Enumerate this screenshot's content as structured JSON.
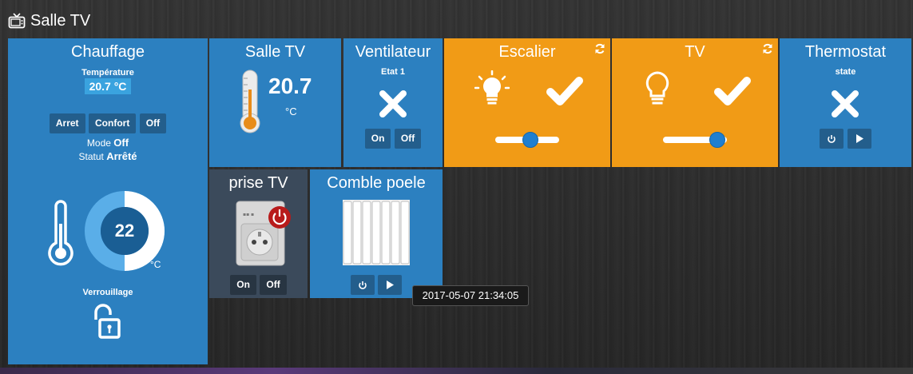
{
  "room": {
    "title": "Salle TV",
    "icon": "tv-icon"
  },
  "heating": {
    "title": "Chauffage",
    "temp_label": "Température",
    "temp_value": "20.7 °C",
    "mode_buttons": [
      "Arret",
      "Confort",
      "Off"
    ],
    "mode_label": "Mode",
    "mode_value": "Off",
    "status_label": "Statut",
    "status_value": "Arrêté",
    "setpoint": "22",
    "unit": "°C",
    "lock_label": "Verrouillage"
  },
  "temp_sensor": {
    "title": "Salle TV",
    "value": "20.7",
    "unit": "°C"
  },
  "fan": {
    "title": "Ventilateur",
    "state_label": "Etat 1",
    "buttons": [
      "On",
      "Off"
    ]
  },
  "stairs": {
    "title": "Escalier",
    "dimmer_level": 0.55
  },
  "tv_light": {
    "title": "TV",
    "dimmer_level": 0.85
  },
  "thermostat": {
    "title": "Thermostat",
    "state_label": "state"
  },
  "plug": {
    "title": "prise TV",
    "buttons": [
      "On",
      "Off"
    ]
  },
  "attic": {
    "title": "Comble poele"
  },
  "tooltip": {
    "text": "2017-05-07 21:34:05"
  },
  "colors": {
    "blue": "#2c80c0",
    "orange": "#f19b16",
    "grey": "#3b4a5b",
    "ring_light": "#5aaee8",
    "ring_dark": "#1a5e94"
  }
}
